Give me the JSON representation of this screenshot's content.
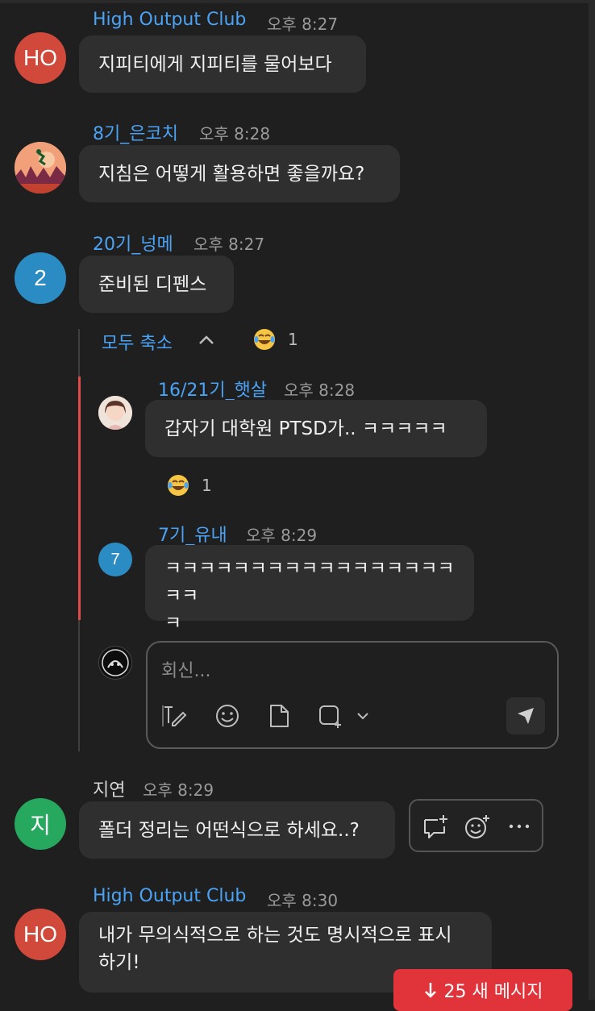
{
  "messages": [
    {
      "name": "High Output Club",
      "time": "오후 8:27",
      "avatar": "HO",
      "avatar_color": "#d0493b",
      "text": "지피티에게 지피티를 물어보다"
    },
    {
      "name": "8기_은코치",
      "time": "오후 8:28",
      "avatar_icon": "runner-landscape-avatar",
      "text": "지침은 어떻게 활용하면 좋을까요?"
    },
    {
      "name": "20기_넝메",
      "time": "오후 8:27",
      "avatar": "2",
      "avatar_color": "#2b8cc4",
      "text": "준비된 디펜스"
    }
  ],
  "thread": {
    "collapse_label": "모두 축소",
    "reaction": {
      "emoji": "joy-emoji",
      "count": "1"
    },
    "replies": [
      {
        "name": "16/21기_햇살",
        "time": "오후 8:28",
        "avatar_icon": "photo-avatar",
        "text": "갑자기 대학원 PTSD가.. ㅋㅋㅋㅋㅋ",
        "reaction": {
          "emoji": "joy-emoji",
          "count": "1"
        }
      },
      {
        "name": "7기_유내",
        "time": "오후 8:29",
        "avatar": "7",
        "avatar_color": "#2b8cc4",
        "text_line1": "ㅋㅋㅋㅋㅋㅋㅋㅋㅋㅋㅋㅋㅋㅋㅋㅋㅋㅋㅋ",
        "text_line2": "ㅋ"
      }
    ],
    "reply_placeholder": "회신..."
  },
  "messages2": [
    {
      "name": "지연",
      "time": "오후 8:29",
      "avatar": "지",
      "avatar_color": "#27a85f",
      "text": "폴더 정리는 어떤식으로 하세요..?"
    },
    {
      "name": "High Output Club",
      "time": "오후 8:30",
      "avatar": "HO",
      "avatar_color": "#d0493b",
      "text_line1": "내가 무의식적으로 하는 것도 명시적으로 표시",
      "text_line2": "하기!"
    }
  ],
  "new_messages_label": "25 새 메시지",
  "colors": {
    "accent": "#4aa3f5",
    "alert": "#e0333a",
    "thread_marker": "#e04a4a"
  }
}
